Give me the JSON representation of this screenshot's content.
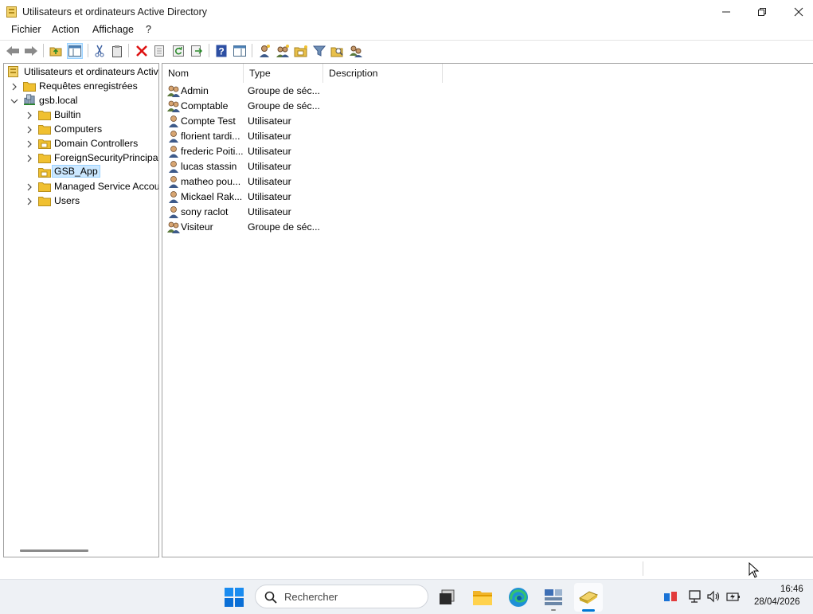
{
  "window": {
    "title": "Utilisateurs et ordinateurs Active Directory"
  },
  "menu": {
    "items": [
      "Fichier",
      "Action",
      "Affichage",
      "?"
    ]
  },
  "toolbar": {
    "buttons": [
      "back-arrow-icon",
      "forward-arrow-icon",
      "up-folder-icon",
      "show-hide-console-tree-icon",
      "cut-icon",
      "paste-icon",
      "delete-icon",
      "properties-icon",
      "refresh-icon",
      "export-list-icon",
      "help-icon",
      "show-action-pane-icon",
      "new-user-icon",
      "new-group-icon",
      "new-ou-icon",
      "filter-icon",
      "find-icon",
      "add-to-group-icon"
    ]
  },
  "tree": {
    "root": "Utilisateurs et ordinateurs Active Directory",
    "saved_queries": "Requêtes enregistrées",
    "domain": "gsb.local",
    "children": [
      "Builtin",
      "Computers",
      "Domain Controllers",
      "ForeignSecurityPrincipals",
      "GSB_App",
      "Managed Service Accounts",
      "Users"
    ],
    "selected": "GSB_App"
  },
  "list": {
    "columns": [
      "Nom",
      "Type",
      "Description"
    ],
    "rows": [
      {
        "name": "Admin",
        "type": "Groupe de séc...",
        "kind": "group"
      },
      {
        "name": "Comptable",
        "type": "Groupe de séc...",
        "kind": "group"
      },
      {
        "name": "Compte Test",
        "type": "Utilisateur",
        "kind": "user"
      },
      {
        "name": "florient tardi...",
        "type": "Utilisateur",
        "kind": "user"
      },
      {
        "name": "frederic Poiti...",
        "type": "Utilisateur",
        "kind": "user"
      },
      {
        "name": "lucas stassin",
        "type": "Utilisateur",
        "kind": "user"
      },
      {
        "name": "matheo pou...",
        "type": "Utilisateur",
        "kind": "user"
      },
      {
        "name": "Mickael Rak...",
        "type": "Utilisateur",
        "kind": "user"
      },
      {
        "name": "sony raclot",
        "type": "Utilisateur",
        "kind": "user"
      },
      {
        "name": "Visiteur",
        "type": "Groupe de séc...",
        "kind": "group"
      }
    ]
  },
  "taskbar": {
    "search_placeholder": "Rechercher",
    "time": "16:46",
    "date": "28/04/2026"
  },
  "colors": {
    "selection_bg": "#cce8ff",
    "selection_border": "#99d1ff",
    "folder_yellow": "#f0c030",
    "taskbar_bg": "#eef1f5",
    "windows_blue": "#0078d4"
  }
}
